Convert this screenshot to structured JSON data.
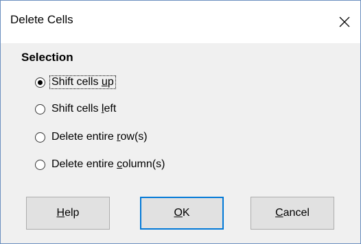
{
  "dialog": {
    "title": "Delete Cells",
    "close_icon": "close-icon"
  },
  "selection": {
    "label": "Selection",
    "selected": 0,
    "options": [
      {
        "pre": "Shift cells ",
        "mn": "u",
        "post": "p"
      },
      {
        "pre": "Shift cells ",
        "mn": "l",
        "post": "eft"
      },
      {
        "pre": "Delete entire ",
        "mn": "r",
        "post": "ow(s)"
      },
      {
        "pre": "Delete entire ",
        "mn": "c",
        "post": "olumn(s)"
      }
    ]
  },
  "buttons": {
    "help": {
      "mn": "H",
      "post": "elp"
    },
    "ok": {
      "mn": "O",
      "post": "K"
    },
    "cancel": {
      "mn": "C",
      "post": "ancel"
    }
  }
}
